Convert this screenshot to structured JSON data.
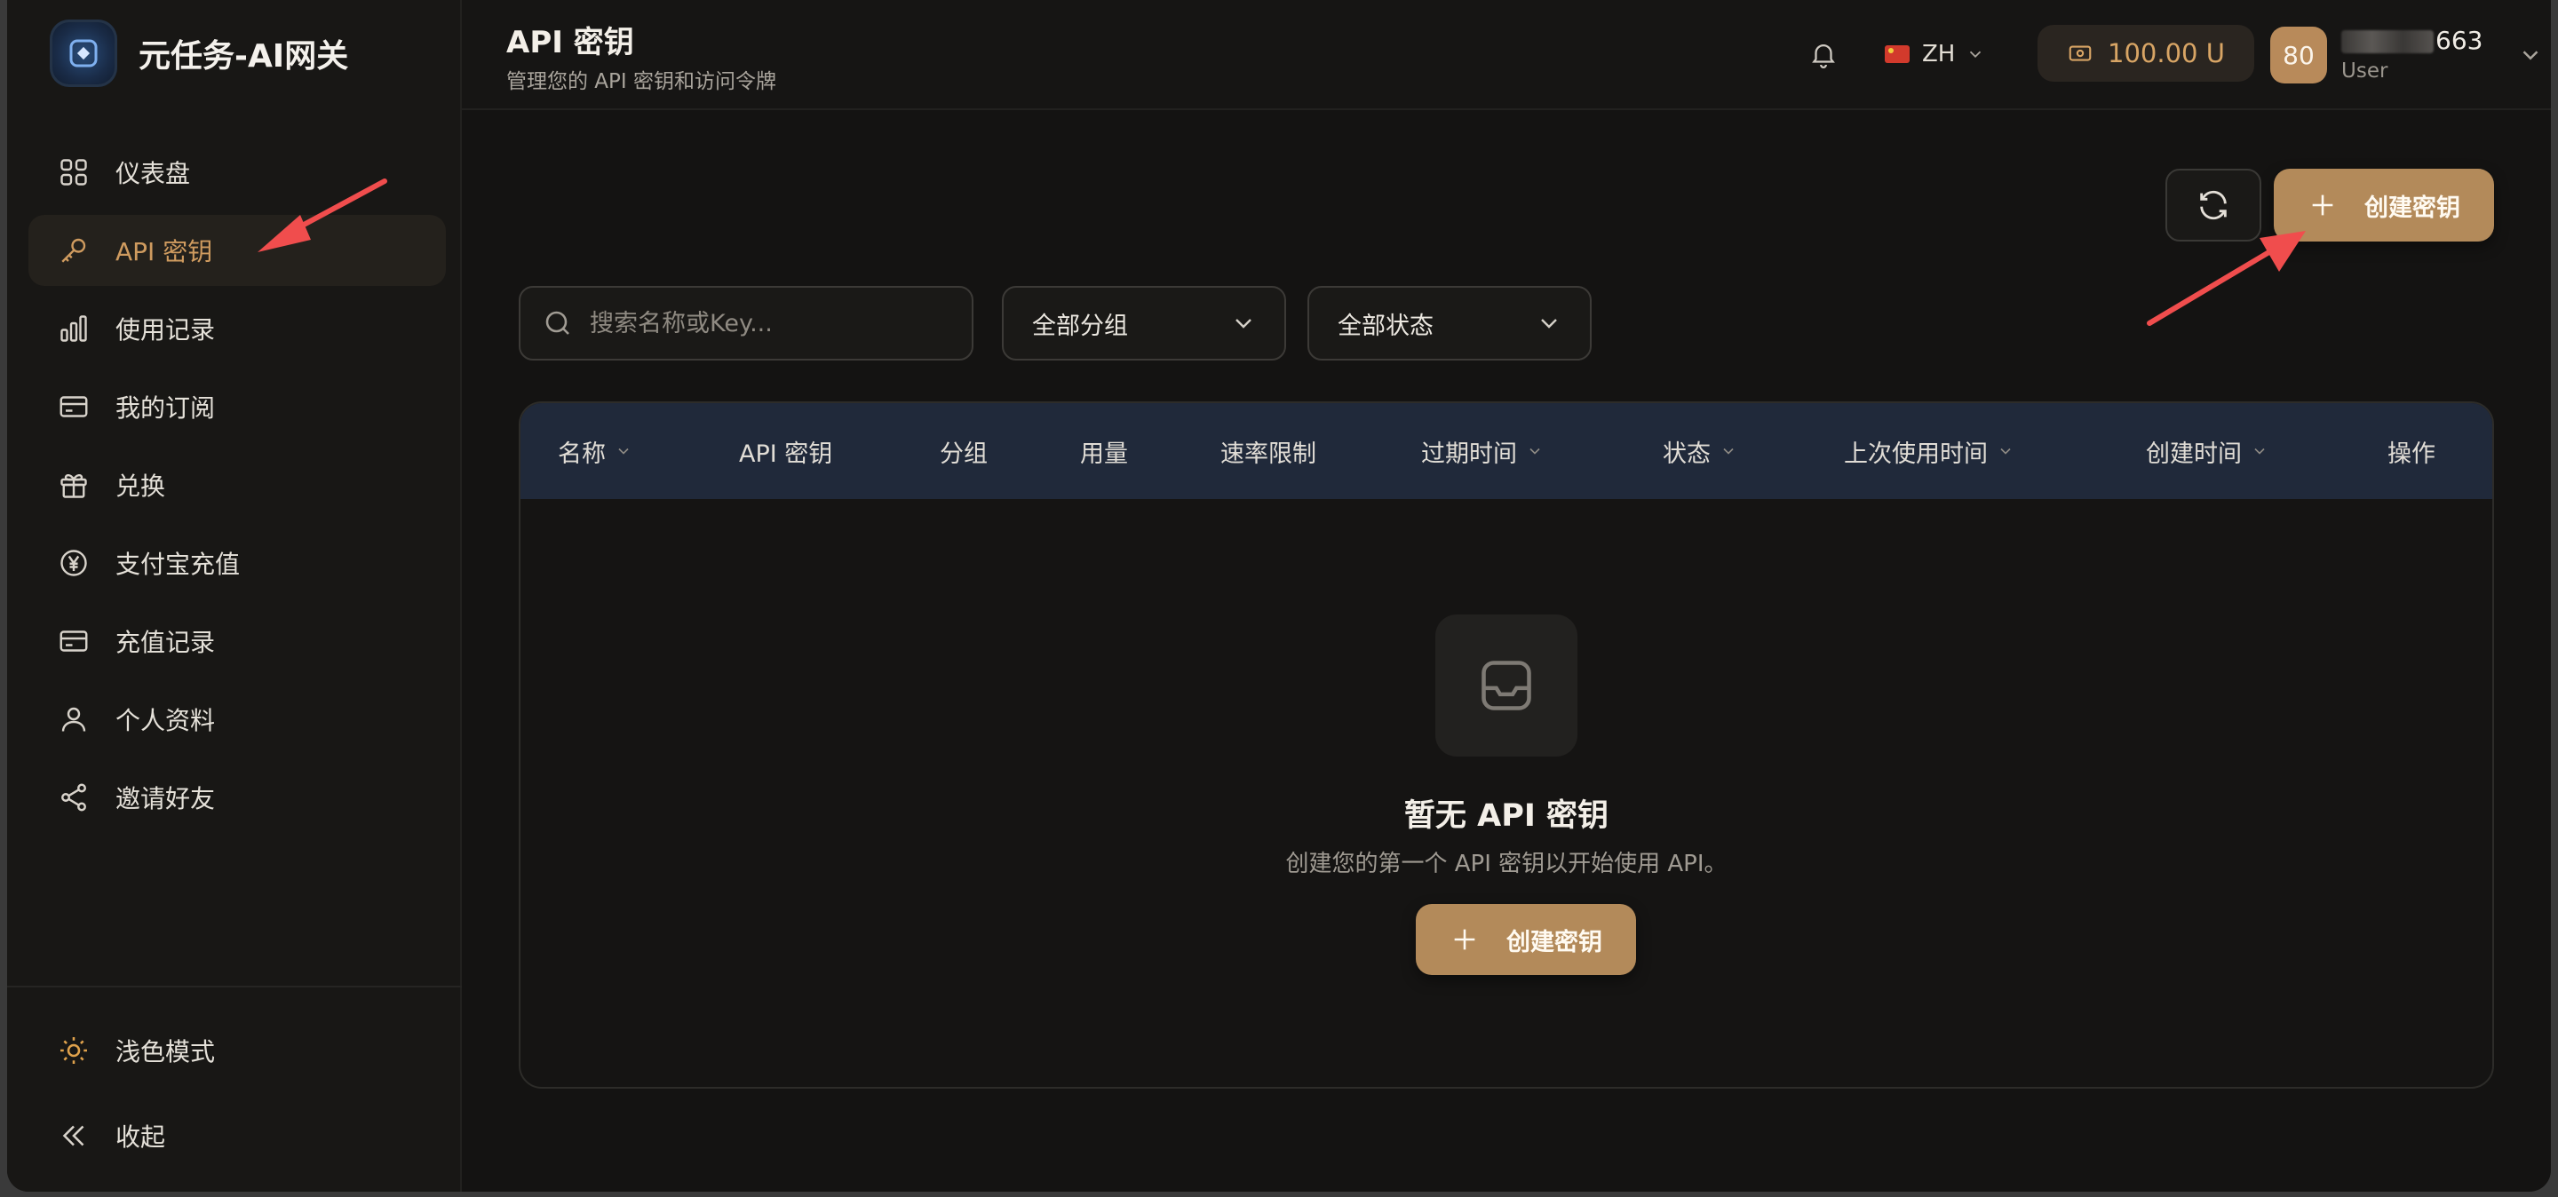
{
  "app": {
    "brand_title": "元任务-AI网关"
  },
  "sidebar": {
    "items": [
      {
        "label": "仪表盘",
        "icon": "dashboard-icon"
      },
      {
        "label": "API 密钥",
        "icon": "key-icon",
        "active": true
      },
      {
        "label": "使用记录",
        "icon": "bar-chart-icon"
      },
      {
        "label": "我的订阅",
        "icon": "card-icon"
      },
      {
        "label": "兑换",
        "icon": "gift-icon"
      },
      {
        "label": "支付宝充值",
        "icon": "yuan-icon"
      },
      {
        "label": "充值记录",
        "icon": "card-icon"
      },
      {
        "label": "个人资料",
        "icon": "user-icon"
      },
      {
        "label": "邀请好友",
        "icon": "share-icon"
      }
    ],
    "bottom": {
      "theme_label": "浅色模式",
      "collapse_label": "收起"
    }
  },
  "header": {
    "title": "API 密钥",
    "subtitle": "管理您的 API 密钥和访问令牌",
    "language": "ZH",
    "balance": "100.00 U",
    "avatar_text": "80",
    "username_suffix": "663",
    "user_role": "User"
  },
  "toolbar": {
    "create_label": "创建密钥",
    "search_placeholder": "搜索名称或Key...",
    "group_filter": "全部分组",
    "status_filter": "全部状态"
  },
  "table": {
    "columns": [
      "名称",
      "API 密钥",
      "分组",
      "用量",
      "速率限制",
      "过期时间",
      "状态",
      "上次使用时间",
      "创建时间",
      "操作"
    ]
  },
  "empty_state": {
    "title": "暂无 API 密钥",
    "description": "创建您的第一个 API 密钥以开始使用 API。",
    "button_label": "创建密钥"
  },
  "colors": {
    "accent": "#b38a5a",
    "active_text": "#cf9b5f",
    "table_header": "#20293a",
    "annotation_arrow": "#f04d4d"
  }
}
